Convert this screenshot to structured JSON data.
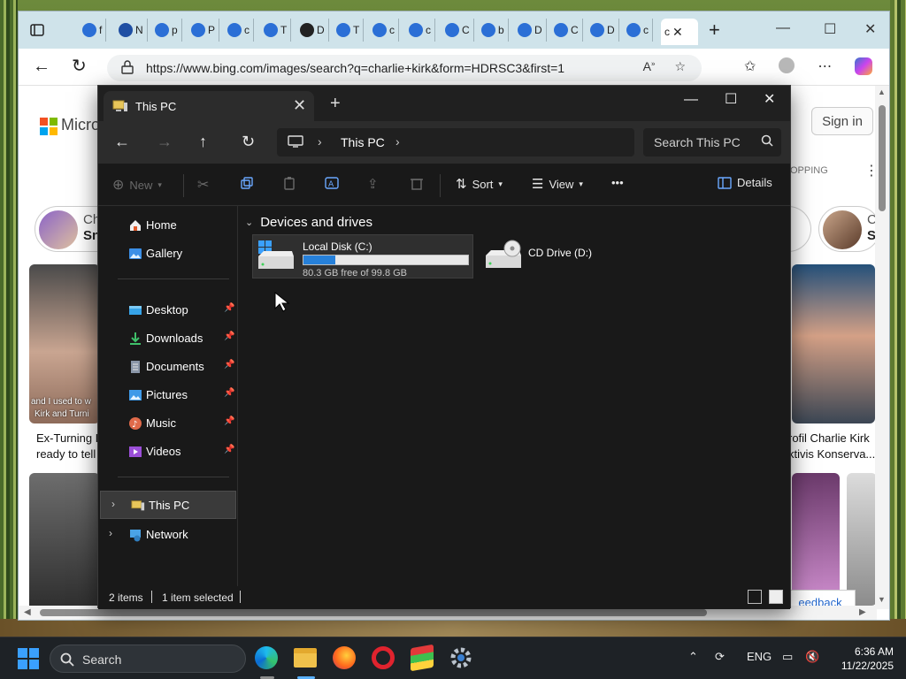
{
  "browser": {
    "url": "https://www.bing.com/images/search?q=charlie+kirk&form=HDRSC3&first=1",
    "tabs": [
      {
        "glyph": "f",
        "color": "#2b6fd6"
      },
      {
        "glyph": "N",
        "color": "#1f4fa3"
      },
      {
        "glyph": "p",
        "color": "#2b6fd6"
      },
      {
        "glyph": "P",
        "color": "#2b6fd6"
      },
      {
        "glyph": "c",
        "color": "#2b6fd6"
      },
      {
        "glyph": "T",
        "color": "#2b6fd6"
      },
      {
        "glyph": "D",
        "color": "#222"
      },
      {
        "glyph": "T",
        "color": "#2b6fd6"
      },
      {
        "glyph": "c",
        "color": "#2b6fd6"
      },
      {
        "glyph": "c",
        "color": "#2b6fd6"
      },
      {
        "glyph": "C",
        "color": "#2b6fd6"
      },
      {
        "glyph": "b",
        "color": "#2b6fd6"
      },
      {
        "glyph": "D",
        "color": "#2b6fd6"
      },
      {
        "glyph": "C",
        "color": "#2b6fd6"
      },
      {
        "glyph": "D",
        "color": "#2b6fd6"
      },
      {
        "glyph": "c",
        "color": "#2b6fd6"
      }
    ],
    "page": {
      "ms_text": "Micros",
      "signin_label": "Sign in",
      "shopping_label": "OPPING",
      "chip_left_t1": "Ch",
      "chip_left_t2": "Sn",
      "chip_right_t1": "C",
      "chip_right_t2": "S",
      "caption_left_1": "Ex-Turning F",
      "caption_left_2": "ready to tell",
      "caption_right_1": "rofil Charlie Kirk",
      "caption_right_2": "ktivis Konserva...",
      "overlay_text_1": "and I used to w",
      "overlay_text_2": "Kirk and Turni",
      "feedback_label": "eedback"
    }
  },
  "explorer": {
    "tab_title": "This PC",
    "new_tab_symbol": "+",
    "breadcrumb": "This PC",
    "search_placeholder": "Search This PC",
    "commands": {
      "new": "New",
      "sort": "Sort",
      "view": "View",
      "more": "•••",
      "details": "Details"
    },
    "sidebar": {
      "home": "Home",
      "gallery": "Gallery",
      "desktop": "Desktop",
      "downloads": "Downloads",
      "documents": "Documents",
      "pictures": "Pictures",
      "music": "Music",
      "videos": "Videos",
      "this_pc": "This PC",
      "network": "Network"
    },
    "group_title": "Devices and drives",
    "drives": {
      "c": {
        "name": "Local Disk (C:)",
        "free_text": "80.3 GB free of 99.8 GB",
        "used_fraction": 0.195
      },
      "d": {
        "name": "CD Drive (D:)"
      }
    },
    "status": {
      "items": "2 items",
      "selected": "1 item selected"
    }
  },
  "taskbar": {
    "search_label": "Search",
    "lang": "ENG",
    "time": "6:36 AM",
    "date": "11/22/2025"
  }
}
